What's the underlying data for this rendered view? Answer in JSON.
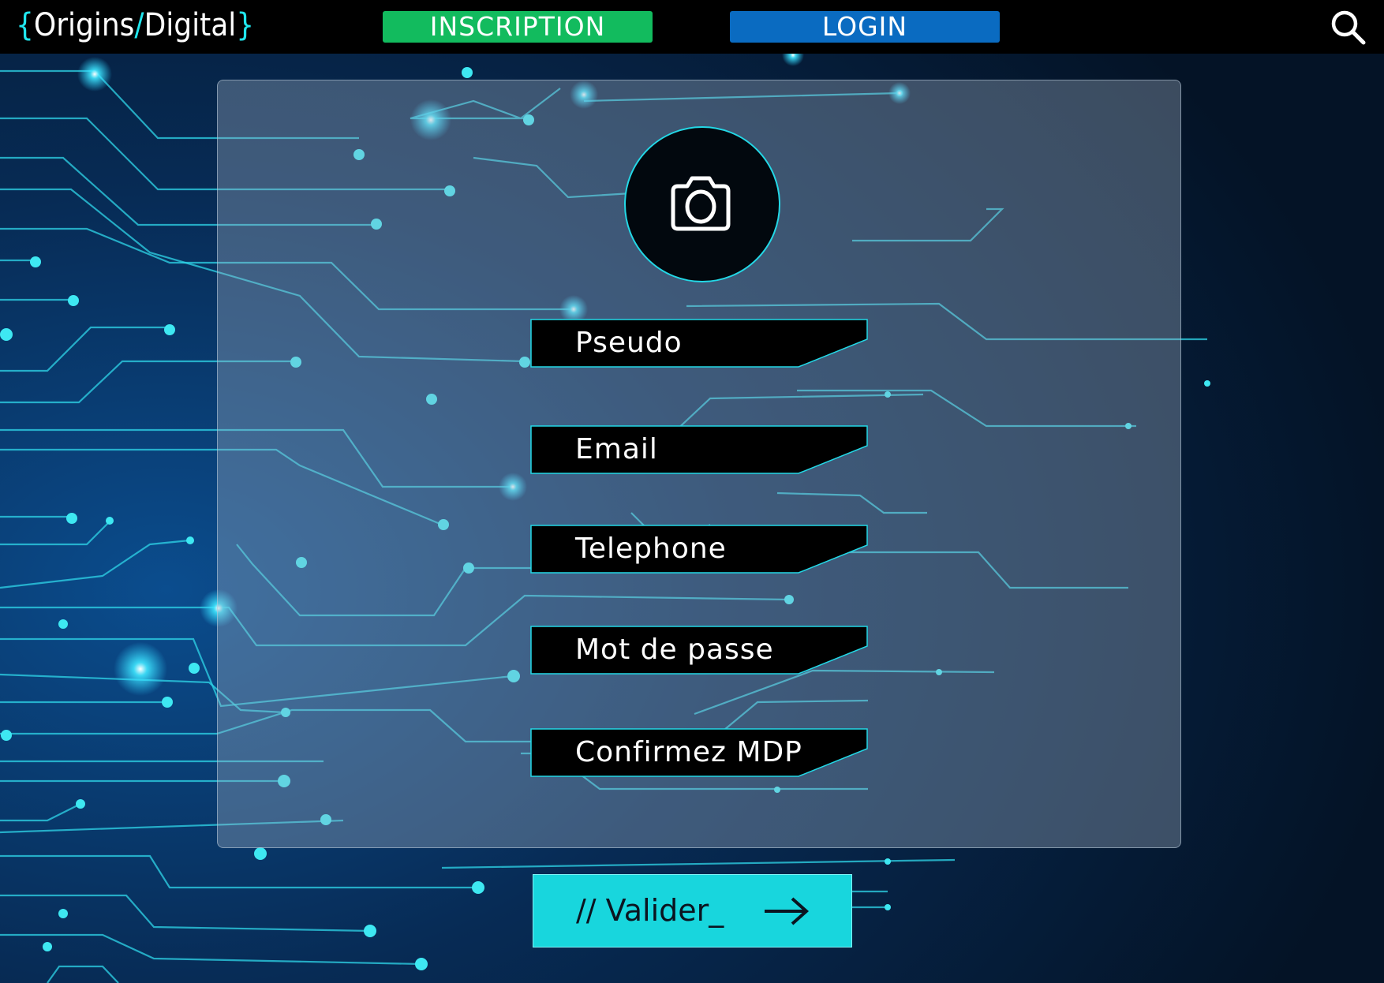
{
  "brand": {
    "open_brace": "{",
    "name_part1": "Origins",
    "slash": "/",
    "name_part2": "Digital",
    "close_brace": "}"
  },
  "nav": {
    "inscription_label": "INSCRIPTION",
    "login_label": "LOGIN",
    "search_icon": "search-icon"
  },
  "form": {
    "avatar_icon": "camera-icon",
    "fields": [
      {
        "label": "Pseudo"
      },
      {
        "label": "Email"
      },
      {
        "label": "Telephone"
      },
      {
        "label": "Mot de passe"
      },
      {
        "label": "Confirmez MDP"
      }
    ],
    "submit_label": "// Valider_",
    "submit_icon": "arrow-right-icon"
  },
  "colors": {
    "background": "#06192e",
    "accent_cyan": "#20e6ee",
    "inscription_green": "#12bb5e",
    "login_blue": "#0a6bc1",
    "submit_cyan": "#18d6dd"
  }
}
